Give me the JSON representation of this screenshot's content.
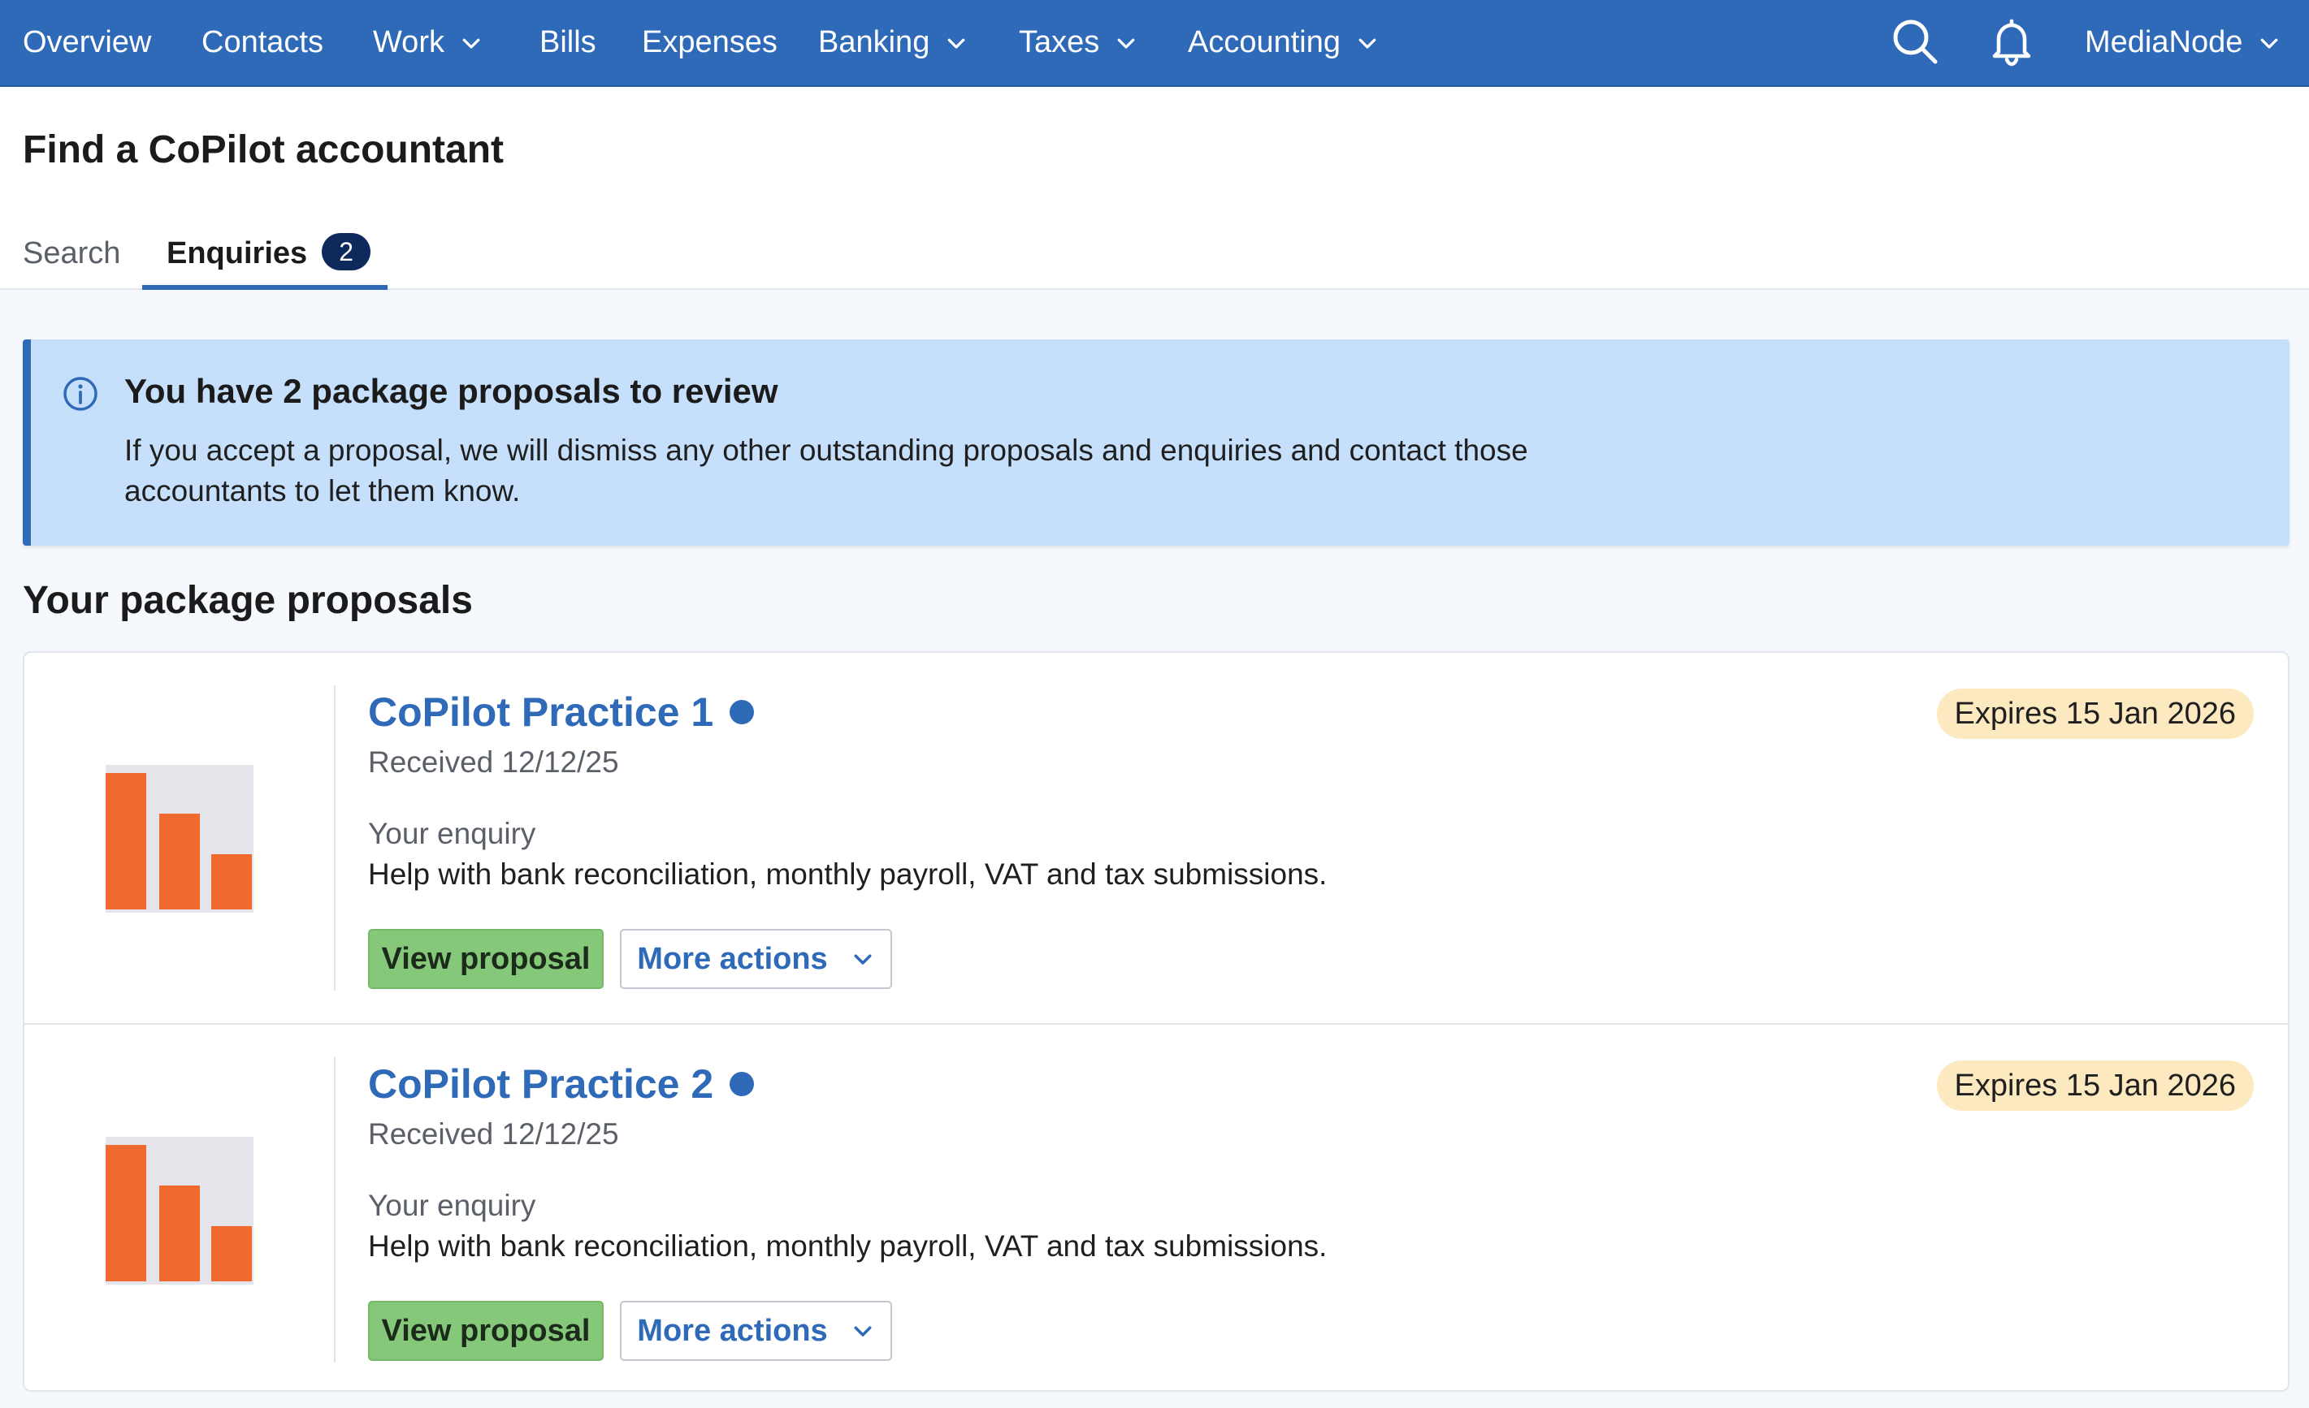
{
  "nav": {
    "items": [
      {
        "label": "Overview"
      },
      {
        "label": "Contacts"
      },
      {
        "label": "Work"
      },
      {
        "label": "Bills"
      },
      {
        "label": "Expenses"
      },
      {
        "label": "Banking"
      },
      {
        "label": "Taxes"
      },
      {
        "label": "Accounting"
      }
    ],
    "account_label": "MediaNode",
    "icons": {
      "search": "search-icon",
      "notifications": "bell-icon",
      "dropdown": "chevron-down-icon"
    },
    "colors": {
      "background": "#2f6ab8",
      "text": "#ffffff"
    }
  },
  "page": {
    "title": "Find a CoPilot accountant",
    "tabs": [
      {
        "label": "Search",
        "selected": false
      },
      {
        "label": "Enquiries",
        "badge": "2",
        "selected": true
      }
    ]
  },
  "banner": {
    "title": "You have 2 package proposals to review",
    "body": "If you accept a proposal, we will dismiss any other outstanding proposals and enquiries and contact those accountants to let them know.",
    "icon": "info-icon",
    "colors": {
      "background": "#c6e0fb",
      "accent": "#2f6ab8"
    }
  },
  "proposals": {
    "section_title": "Your package proposals",
    "items": [
      {
        "name": "CoPilot Practice 1",
        "received": "Received 12/12/25",
        "expires": "Expires 15 Jan 2026",
        "enquiry_label": "Your enquiry",
        "enquiry_text": "Help with bank reconciliation, monthly payroll, VAT and tax submissions.",
        "view_label": "View proposal",
        "more_label": "More actions",
        "unread": true,
        "logo": "bar-chart-logo"
      },
      {
        "name": "CoPilot Practice 2",
        "received": "Received 12/12/25",
        "expires": "Expires 15 Jan 2026",
        "enquiry_label": "Your enquiry",
        "enquiry_text": "Help with bank reconciliation, monthly payroll, VAT and tax submissions.",
        "view_label": "View proposal",
        "more_label": "More actions",
        "unread": true,
        "logo": "bar-chart-logo"
      }
    ],
    "colors": {
      "view_button": "#86c87a",
      "expires_badge": "#fde9c0",
      "logo_bars": "#ee6a2f",
      "logo_bg": "#e4e5ea"
    }
  }
}
